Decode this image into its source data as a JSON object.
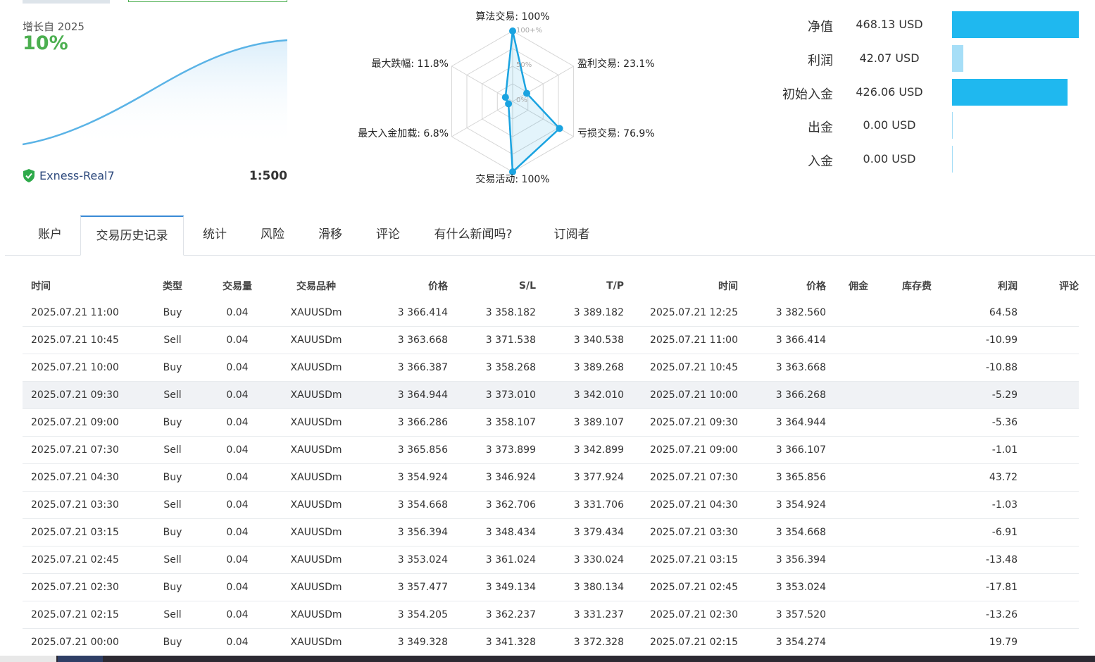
{
  "summary": {
    "growth_label": "增长自 2025",
    "growth_value": "10%",
    "account_name": "Exness-Real7",
    "leverage": "1:500"
  },
  "radar": {
    "axis_labels": {
      "algo": "算法交易: 100%",
      "profit": "盈利交易: 23.1%",
      "loss": "亏损交易: 76.9%",
      "activity": "交易活动: 100%",
      "deposit_load": "最大入金加载: 6.8%",
      "drawdown": "最大跌幅: 11.8%"
    },
    "scale_labels": {
      "max": "100+%",
      "mid": "50%",
      "min": "0%"
    },
    "values": {
      "algo": 100,
      "profit": 23.1,
      "loss": 76.9,
      "activity": 100,
      "deposit_load": 6.8,
      "drawdown": 11.8
    },
    "accent": "#1aa3e0"
  },
  "stats": [
    {
      "label": "净值",
      "value": "468.13 USD",
      "amount": 468.13,
      "color": "#1fb8ef"
    },
    {
      "label": "利润",
      "value": "42.07 USD",
      "amount": 42.07,
      "color": "#a6def7"
    },
    {
      "label": "初始入金",
      "value": "426.06 USD",
      "amount": 426.06,
      "color": "#1fb8ef"
    },
    {
      "label": "出金",
      "value": "0.00 USD",
      "amount": 0,
      "color": "#a6def7"
    },
    {
      "label": "入金",
      "value": "0.00 USD",
      "amount": 0,
      "color": "#a6def7"
    }
  ],
  "tabs": [
    {
      "label": "账户"
    },
    {
      "label": "交易历史记录"
    },
    {
      "label": "统计"
    },
    {
      "label": "风险"
    },
    {
      "label": "滑移"
    },
    {
      "label": "评论"
    },
    {
      "label": "有什么新闻吗?"
    },
    {
      "label": "订阅者"
    }
  ],
  "active_tab": "交易历史记录",
  "table": {
    "headers": [
      "时间",
      "类型",
      "交易量",
      "交易品种",
      "价格",
      "S/L",
      "T/P",
      "时间",
      "价格",
      "佣金",
      "库存费",
      "利润",
      "评论"
    ],
    "rows": [
      [
        "2025.07.21 11:00",
        "Buy",
        "0.04",
        "XAUUSDm",
        "3 366.414",
        "3 358.182",
        "3 389.182",
        "2025.07.21 12:25",
        "3 382.560",
        "",
        "",
        "64.58",
        ""
      ],
      [
        "2025.07.21 10:45",
        "Sell",
        "0.04",
        "XAUUSDm",
        "3 363.668",
        "3 371.538",
        "3 340.538",
        "2025.07.21 11:00",
        "3 366.414",
        "",
        "",
        "-10.99",
        ""
      ],
      [
        "2025.07.21 10:00",
        "Buy",
        "0.04",
        "XAUUSDm",
        "3 366.387",
        "3 358.268",
        "3 389.268",
        "2025.07.21 10:45",
        "3 363.668",
        "",
        "",
        "-10.88",
        ""
      ],
      [
        "2025.07.21 09:30",
        "Sell",
        "0.04",
        "XAUUSDm",
        "3 364.944",
        "3 373.010",
        "3 342.010",
        "2025.07.21 10:00",
        "3 366.268",
        "",
        "",
        "-5.29",
        ""
      ],
      [
        "2025.07.21 09:00",
        "Buy",
        "0.04",
        "XAUUSDm",
        "3 366.286",
        "3 358.107",
        "3 389.107",
        "2025.07.21 09:30",
        "3 364.944",
        "",
        "",
        "-5.36",
        ""
      ],
      [
        "2025.07.21 07:30",
        "Sell",
        "0.04",
        "XAUUSDm",
        "3 365.856",
        "3 373.899",
        "3 342.899",
        "2025.07.21 09:00",
        "3 366.107",
        "",
        "",
        "-1.01",
        ""
      ],
      [
        "2025.07.21 04:30",
        "Buy",
        "0.04",
        "XAUUSDm",
        "3 354.924",
        "3 346.924",
        "3 377.924",
        "2025.07.21 07:30",
        "3 365.856",
        "",
        "",
        "43.72",
        ""
      ],
      [
        "2025.07.21 03:30",
        "Sell",
        "0.04",
        "XAUUSDm",
        "3 354.668",
        "3 362.706",
        "3 331.706",
        "2025.07.21 04:30",
        "3 354.924",
        "",
        "",
        "-1.03",
        ""
      ],
      [
        "2025.07.21 03:15",
        "Buy",
        "0.04",
        "XAUUSDm",
        "3 356.394",
        "3 348.434",
        "3 379.434",
        "2025.07.21 03:30",
        "3 354.668",
        "",
        "",
        "-6.91",
        ""
      ],
      [
        "2025.07.21 02:45",
        "Sell",
        "0.04",
        "XAUUSDm",
        "3 353.024",
        "3 361.024",
        "3 330.024",
        "2025.07.21 03:15",
        "3 356.394",
        "",
        "",
        "-13.48",
        ""
      ],
      [
        "2025.07.21 02:30",
        "Buy",
        "0.04",
        "XAUUSDm",
        "3 357.477",
        "3 349.134",
        "3 380.134",
        "2025.07.21 02:45",
        "3 353.024",
        "",
        "",
        "-17.81",
        ""
      ],
      [
        "2025.07.21 02:15",
        "Sell",
        "0.04",
        "XAUUSDm",
        "3 354.205",
        "3 362.237",
        "3 331.237",
        "2025.07.21 02:30",
        "3 357.520",
        "",
        "",
        "-13.26",
        ""
      ],
      [
        "2025.07.21 00:00",
        "Buy",
        "0.04",
        "XAUUSDm",
        "3 349.328",
        "3 341.328",
        "3 372.328",
        "2025.07.21 02:15",
        "3 354.274",
        "",
        "",
        "19.79",
        ""
      ]
    ],
    "highlighted_row": 3
  }
}
